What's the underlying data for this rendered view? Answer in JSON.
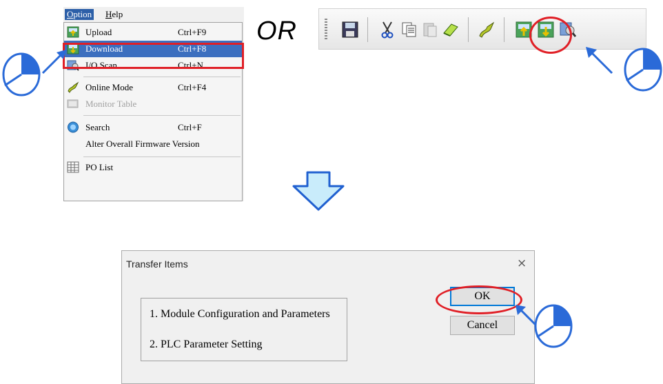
{
  "menubar": {
    "option_label": "Option",
    "help_label": "Help"
  },
  "menu_items": [
    {
      "label": "Upload",
      "shortcut": "Ctrl+F9",
      "icon": "upload-icon"
    },
    {
      "label": "Download",
      "shortcut": "Ctrl+F8",
      "icon": "download-icon"
    },
    {
      "label": "I/O Scan",
      "shortcut": "Ctrl+N",
      "icon": "io-scan-icon"
    },
    {
      "label": "Online Mode",
      "shortcut": "Ctrl+F4",
      "icon": "online-mode-icon"
    },
    {
      "label": "Monitor Table",
      "shortcut": "",
      "icon": "monitor-table-icon"
    },
    {
      "label": "Search",
      "shortcut": "Ctrl+F",
      "icon": "search-icon"
    },
    {
      "label": "Alter Overall Firmware Version",
      "shortcut": "",
      "icon": ""
    },
    {
      "label": "PO List",
      "shortcut": "",
      "icon": "po-list-icon"
    }
  ],
  "or_text": "OR",
  "toolbar_icons": [
    "save-icon",
    "cut-icon",
    "copy-icon",
    "paste-icon",
    "eraser-icon",
    "online-mode-icon",
    "upload-icon",
    "download-icon",
    "io-scan-icon"
  ],
  "dialog": {
    "title": "Transfer Items",
    "close_glyph": "×",
    "items": [
      "1. Module Configuration and Parameters",
      "2. PLC Parameter Setting"
    ],
    "ok_label": "OK",
    "cancel_label": "Cancel"
  },
  "colors": {
    "highlight_red": "#e01f26",
    "pointer_blue": "#2a6ad8",
    "arrow_fill": "#c9ecfb",
    "arrow_stroke": "#2060d0"
  }
}
